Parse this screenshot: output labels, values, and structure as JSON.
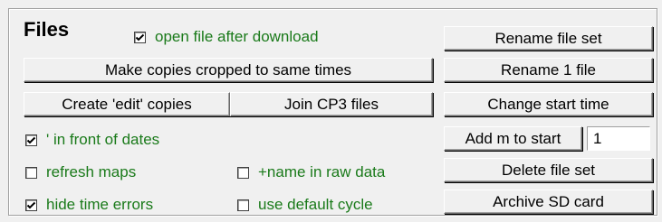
{
  "panel": {
    "title": "Files"
  },
  "checkboxes": {
    "open_after_download": {
      "label": "open file after download",
      "checked": true
    },
    "apostrophe_dates": {
      "label": "'  in front of dates",
      "checked": true
    },
    "refresh_maps": {
      "label": "refresh maps",
      "checked": false
    },
    "name_in_raw_data": {
      "label": "+name in raw data",
      "checked": false
    },
    "hide_time_errors": {
      "label": "hide time errors",
      "checked": true
    },
    "use_default_cycle": {
      "label": "use default cycle",
      "checked": false
    }
  },
  "buttons": {
    "make_copies": "Make copies cropped to same times",
    "create_edit_copies": "Create 'edit' copies",
    "join_cp3": "Join CP3 files",
    "rename_file_set": "Rename file set",
    "rename_1_file": "Rename 1 file",
    "change_start_time": "Change start time",
    "add_m_to_start": "Add m to start",
    "delete_file_set": "Delete file set",
    "archive_sd_card": "Archive SD card"
  },
  "inputs": {
    "add_m_value": "1"
  },
  "colors": {
    "checkbox_label": "#1a7a1a",
    "background": "#f0f0f0"
  }
}
